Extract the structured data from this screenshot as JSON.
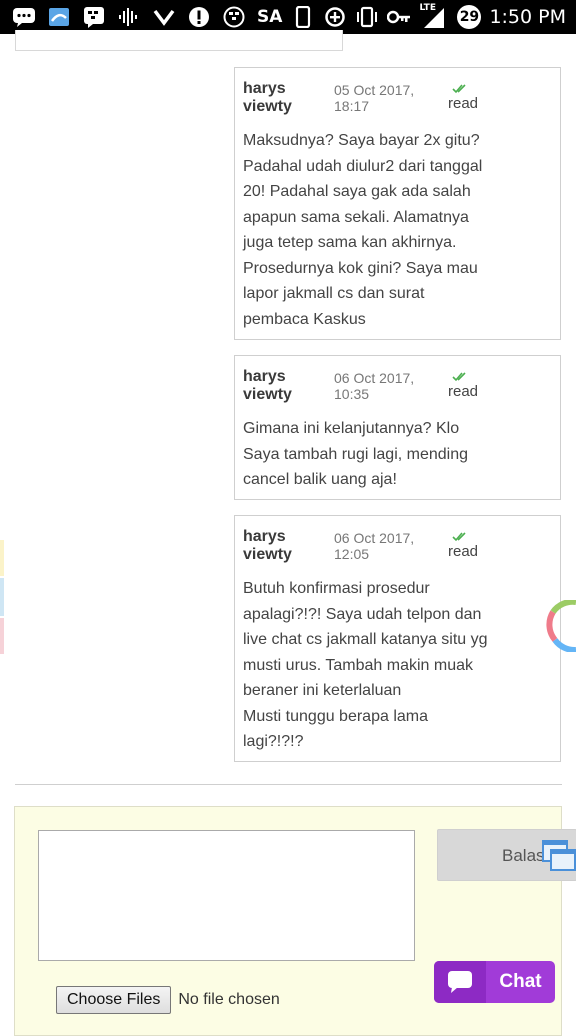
{
  "status_bar": {
    "carrier_text": "SA",
    "network": "LTE",
    "notification_count": "29",
    "time": "1:50 PM"
  },
  "messages": [
    {
      "author": "harys viewty",
      "date": "05 Oct 2017, 18:17",
      "status": "read",
      "body": "Maksudnya? Saya bayar 2x gitu?\nPadahal udah diulur2 dari tanggal\n20! Padahal saya gak ada salah\napapun sama sekali. Alamatnya\njuga tetep sama kan akhirnya.\nProsedurnya kok gini? Saya mau\nlapor jakmall cs dan surat\npembaca Kaskus"
    },
    {
      "author": "harys viewty",
      "date": "06 Oct 2017, 10:35",
      "status": "read",
      "body": "Gimana ini kelanjutannya? Klo\nSaya tambah rugi lagi, mending\ncancel balik uang aja!"
    },
    {
      "author": "harys viewty",
      "date": "06 Oct 2017, 12:05",
      "status": "read",
      "body": "Butuh konfirmasi prosedur\napalagi?!?! Saya udah telpon dan\nlive chat cs jakmall katanya situ yg\nmusti urus. Tambah makin muak\nberaner ini keterlaluan\nMusti tunggu berapa lama\nlagi?!?!?"
    }
  ],
  "reply": {
    "textarea_value": "",
    "submit_label": "Balas",
    "file_button_label": "Choose Files",
    "file_status": "No file chosen"
  },
  "chat_widget": {
    "label": "Chat",
    "icon": "chat-bubble-icon",
    "color": "#a13bd8"
  }
}
